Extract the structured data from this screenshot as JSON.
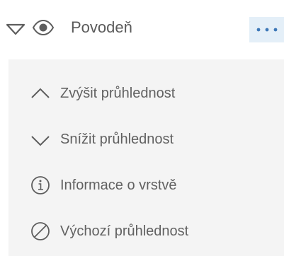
{
  "layer": {
    "title": "Povodeň"
  },
  "menu": {
    "items": [
      {
        "label": "Zvýšit průhlednost",
        "icon": "chevron-up-icon"
      },
      {
        "label": "Snížit průhlednost",
        "icon": "chevron-down-icon"
      },
      {
        "label": "Informace o vrstvě",
        "icon": "info-icon"
      },
      {
        "label": "Výchozí průhlednost",
        "icon": "reset-icon"
      }
    ]
  },
  "colors": {
    "text": "#5f5f5f",
    "menu_background": "#f4f4f4",
    "more_button_background": "#e4eff8",
    "accent": "#3d78b8"
  }
}
